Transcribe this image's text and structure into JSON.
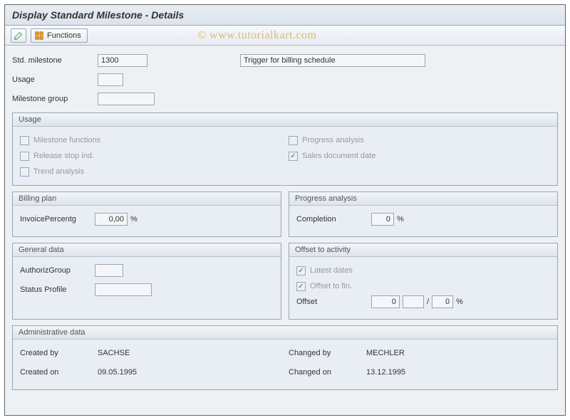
{
  "title": "Display Standard Milestone - Details",
  "toolbar": {
    "functions_label": "Functions"
  },
  "header": {
    "std_milestone_label": "Std. milestone",
    "std_milestone_value": "1300",
    "description_value": "Trigger for billing schedule",
    "usage_label": "Usage",
    "usage_value": "",
    "milestone_group_label": "Milestone group",
    "milestone_group_value": ""
  },
  "usage_box": {
    "title": "Usage",
    "milestone_functions": "Milestone functions",
    "release_stop": "Release stop ind.",
    "trend_analysis": "Trend analysis",
    "progress_analysis": "Progress analysis",
    "sales_doc_date": "Sales document date"
  },
  "billing_plan": {
    "title": "Billing plan",
    "invoice_pct_label": "InvoicePercentg",
    "invoice_pct_value": "0,00",
    "pct_suffix": "%"
  },
  "progress_analysis": {
    "title": "Progress analysis",
    "completion_label": "Completion",
    "completion_value": "0",
    "pct_suffix": "%"
  },
  "general_data": {
    "title": "General data",
    "authoriz_label": "AuthorizGroup",
    "authoriz_value": "",
    "status_label": "Status Profile",
    "status_value": ""
  },
  "offset": {
    "title": "Offset to activity",
    "latest_dates": "Latest dates",
    "offset_to_fin": "Offset to fin.",
    "offset_label": "Offset",
    "offset_value1": "0",
    "offset_value2": "",
    "offset_value3": "0",
    "sep": "/",
    "pct_suffix": "%"
  },
  "admin": {
    "title": "Administrative data",
    "created_by_label": "Created by",
    "created_by_value": "SACHSE",
    "created_on_label": "Created on",
    "created_on_value": "09.05.1995",
    "changed_by_label": "Changed by",
    "changed_by_value": "MECHLER",
    "changed_on_label": "Changed on",
    "changed_on_value": "13.12.1995"
  },
  "watermark": "© www.tutorialkart.com"
}
